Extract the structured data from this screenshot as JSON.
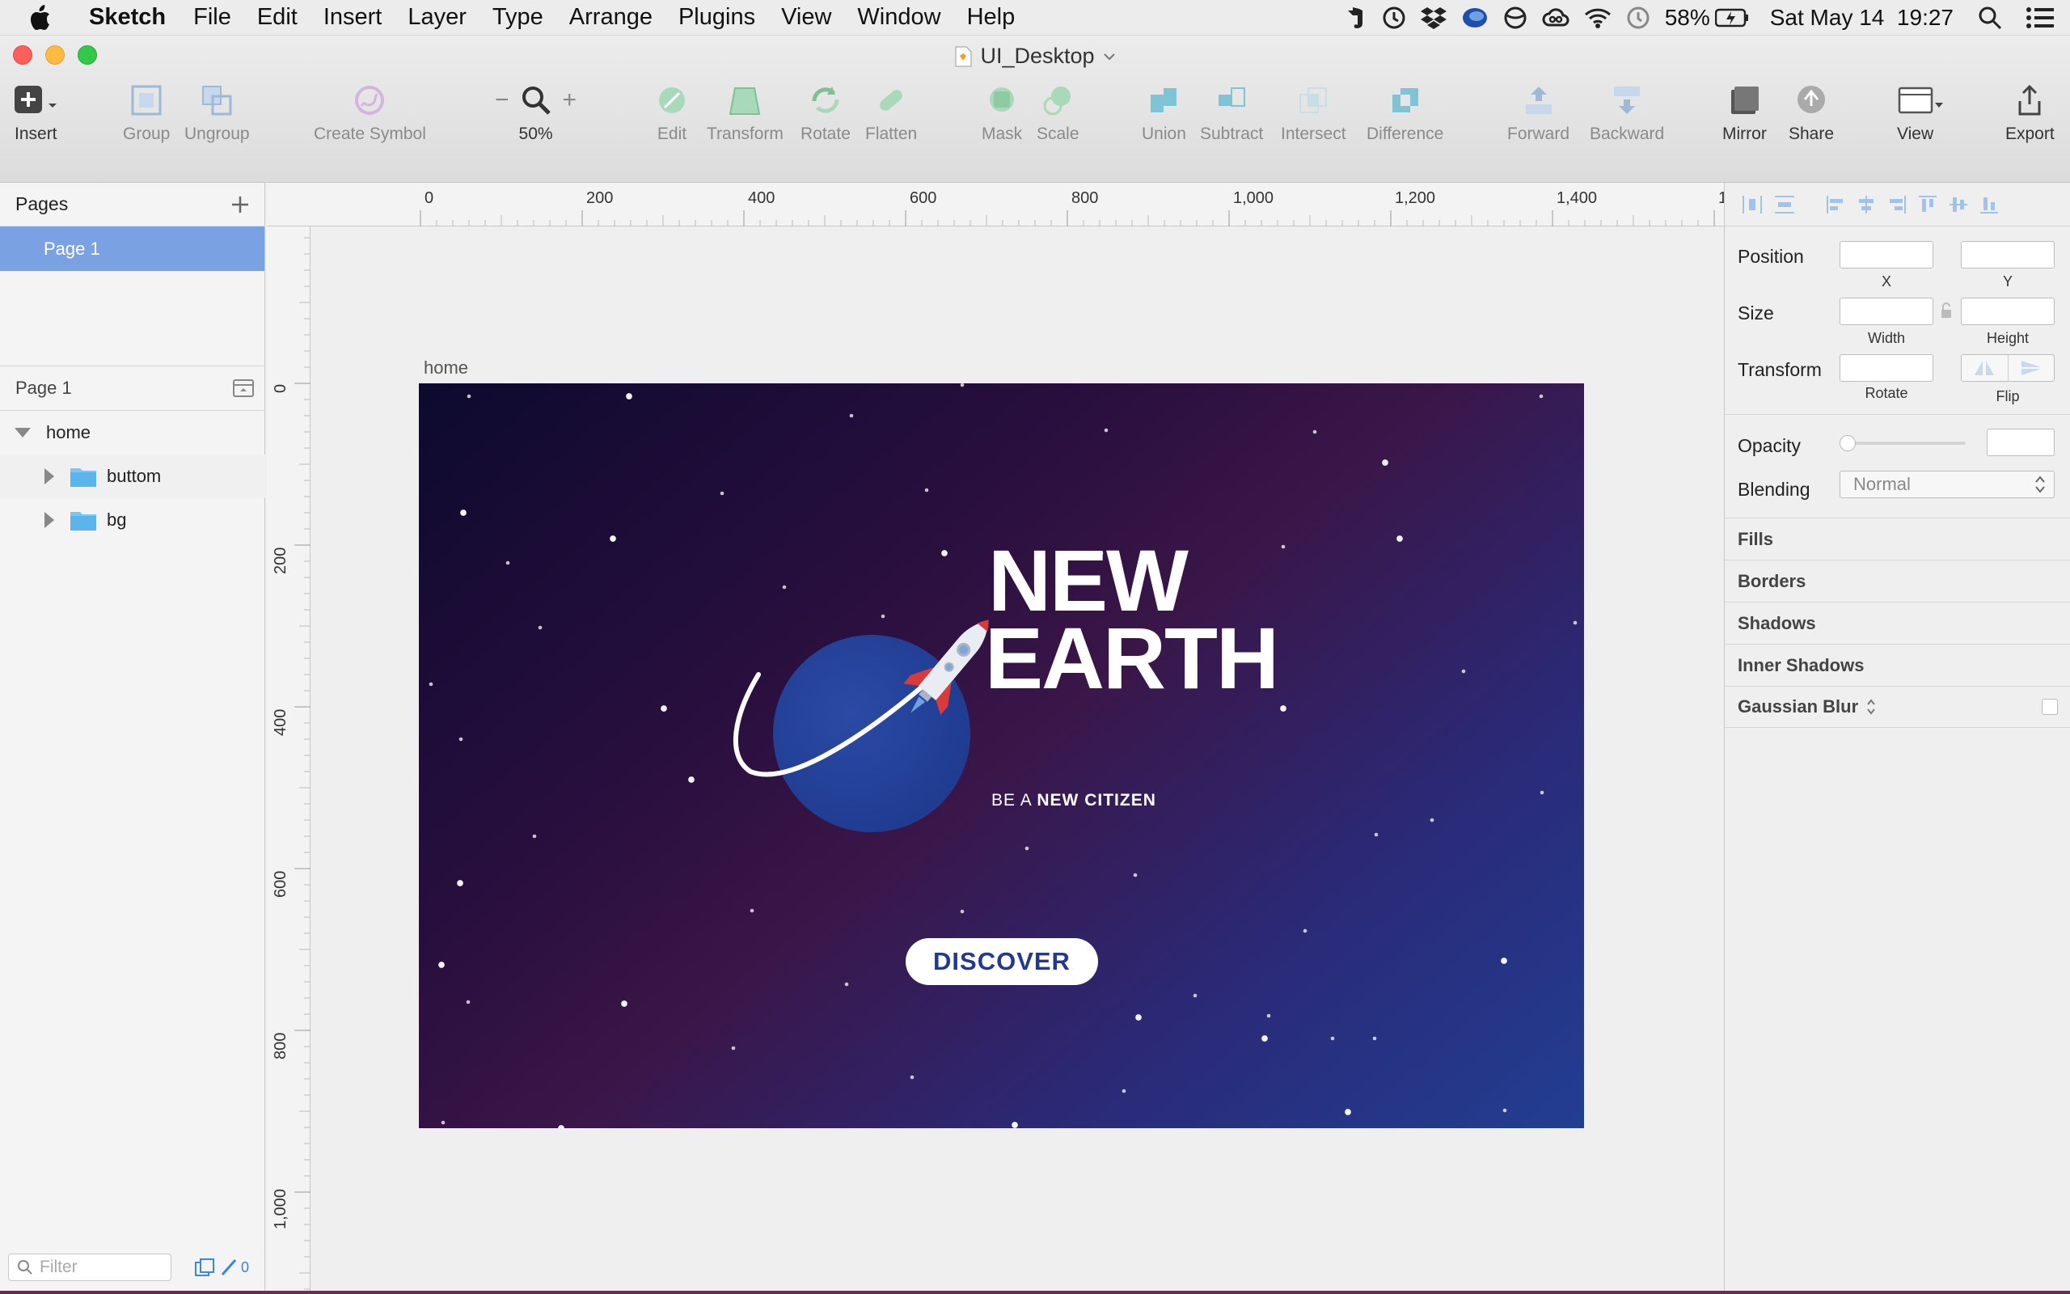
{
  "menubar": {
    "app_name": "Sketch",
    "items": [
      "File",
      "Edit",
      "Insert",
      "Layer",
      "Type",
      "Arrange",
      "Plugins",
      "View",
      "Window",
      "Help"
    ],
    "status_icons": [
      "evernote-icon",
      "clock-icon",
      "dropbox-icon",
      "creative-app-icon",
      "sync-icon",
      "creative-cloud-icon",
      "wifi-icon",
      "time-machine-icon"
    ],
    "battery": "58%",
    "datetime": "Sat May 14  19:27"
  },
  "window": {
    "doc_title": "UI_Desktop"
  },
  "toolbar": {
    "insert": "Insert",
    "group": "Group",
    "ungroup": "Ungroup",
    "create_symbol": "Create Symbol",
    "zoom_level": "50%",
    "edit": "Edit",
    "transform": "Transform",
    "rotate": "Rotate",
    "flatten": "Flatten",
    "mask": "Mask",
    "scale": "Scale",
    "union": "Union",
    "subtract": "Subtract",
    "intersect": "Intersect",
    "difference": "Difference",
    "forward": "Forward",
    "backward": "Backward",
    "mirror": "Mirror",
    "share": "Share",
    "view": "View",
    "export": "Export"
  },
  "sidebar": {
    "pages_title": "Pages",
    "selected_page": "Page 1",
    "layers_page": "Page 1",
    "layers": [
      {
        "name": "home",
        "kind": "artboard"
      },
      {
        "name": "buttom",
        "kind": "group"
      },
      {
        "name": "bg",
        "kind": "group"
      }
    ],
    "filter_placeholder": "Filter",
    "edit_count": "0"
  },
  "rulers": {
    "horizontal": [
      "0",
      "200",
      "400",
      "600",
      "800",
      "1,000",
      "1,200",
      "1,400",
      "1"
    ],
    "vertical": [
      "0",
      "200",
      "400",
      "600",
      "800",
      "1,000"
    ]
  },
  "artboard": {
    "name": "home",
    "title_line1": "NEW",
    "title_line2": "EARTH",
    "tagline_prefix": "BE A ",
    "tagline_bold": "NEW CITIZEN",
    "button": "DISCOVER",
    "colors": {
      "planet": "#233f95",
      "button_text": "#23388f",
      "rocket_red": "#d93a3a"
    }
  },
  "inspector": {
    "position": "Position",
    "x": "X",
    "y": "Y",
    "size": "Size",
    "width": "Width",
    "height": "Height",
    "transform": "Transform",
    "rotate": "Rotate",
    "flip": "Flip",
    "opacity": "Opacity",
    "blending": "Blending",
    "blending_value": "Normal",
    "sections": [
      "Fills",
      "Borders",
      "Shadows",
      "Inner Shadows",
      "Gaussian Blur"
    ]
  }
}
